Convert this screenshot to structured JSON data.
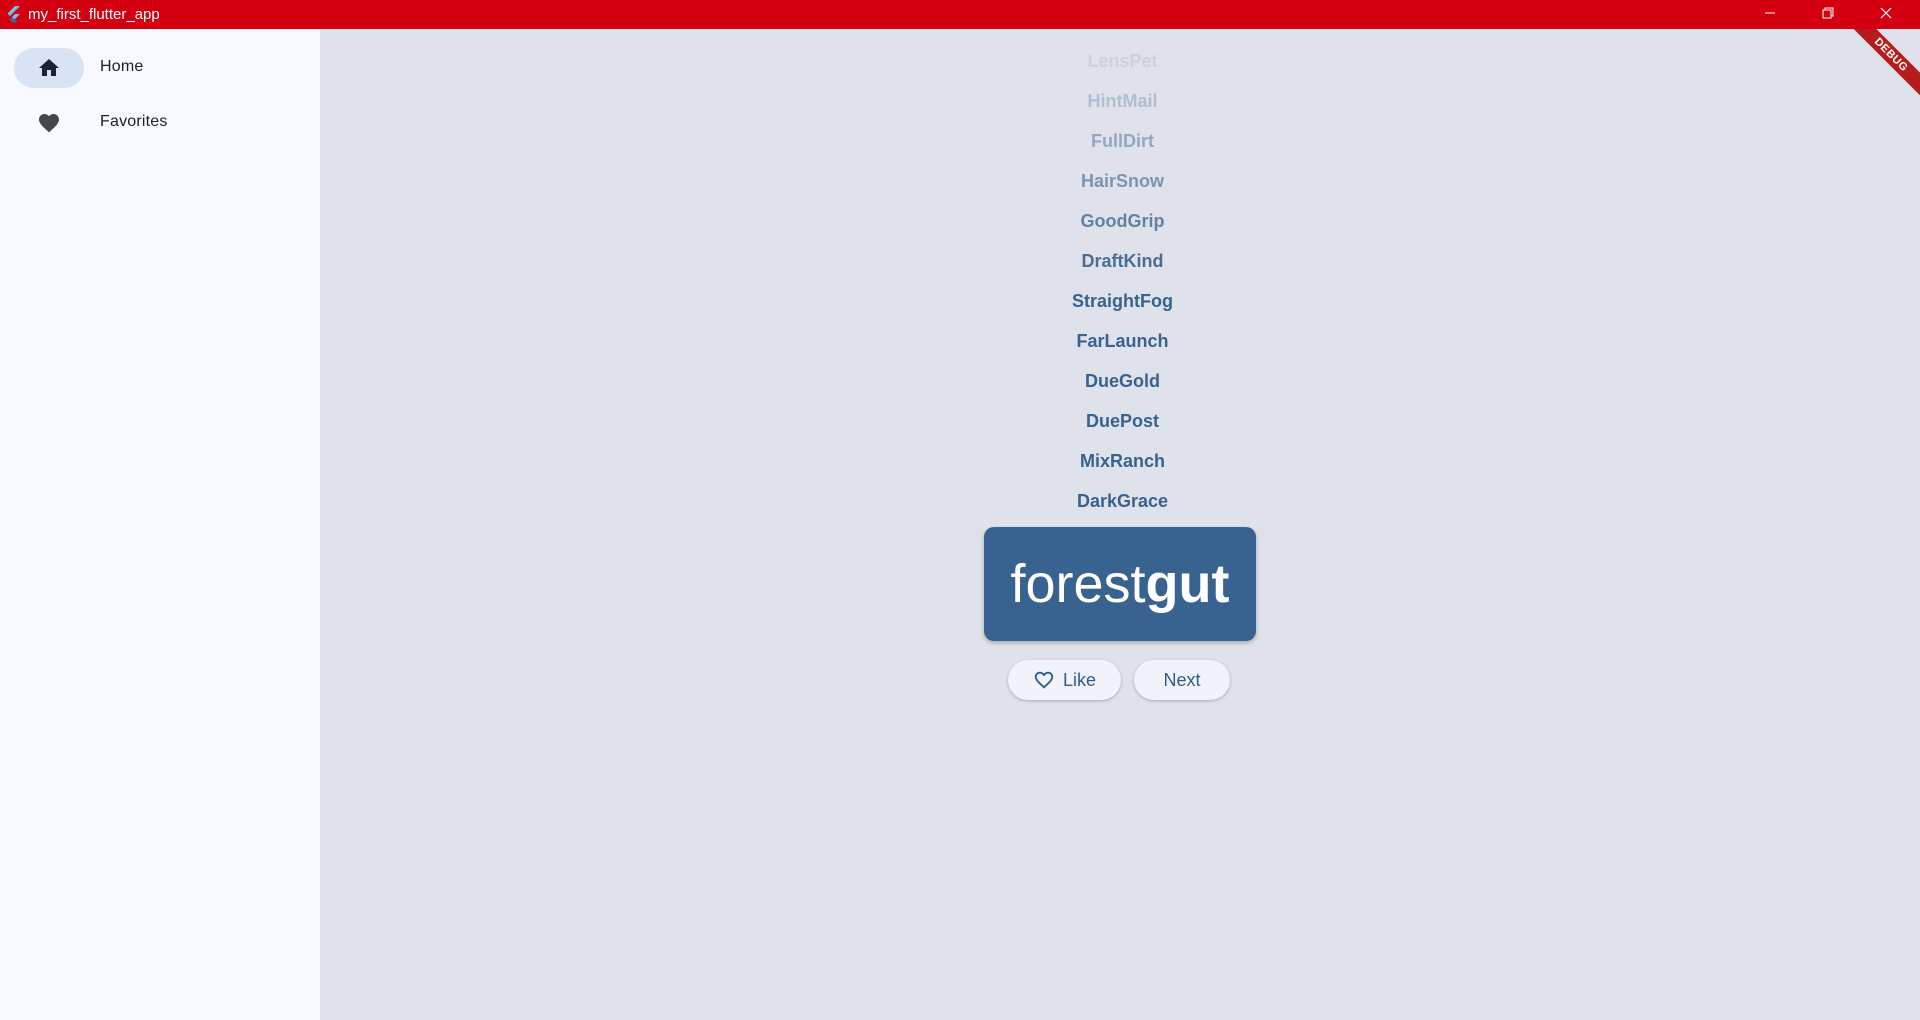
{
  "window": {
    "title": "my_first_flutter_app"
  },
  "colors": {
    "titlebar": "#d40012",
    "sidebar_bg": "#f7f9fe",
    "main_bg": "#dfe2ea",
    "primary": "#38628f",
    "nav_indicator": "#d8e3f4"
  },
  "sidebar": {
    "items": [
      {
        "label": "Home",
        "icon": "home-icon",
        "selected": true
      },
      {
        "label": "Favorites",
        "icon": "heart-icon",
        "selected": false
      }
    ]
  },
  "main": {
    "history": [
      {
        "word": "LensPet",
        "opacity": 0.12
      },
      {
        "word": "HintMail",
        "opacity": 0.28
      },
      {
        "word": "FullDirt",
        "opacity": 0.45
      },
      {
        "word": "HairSnow",
        "opacity": 0.6
      },
      {
        "word": "GoodGrip",
        "opacity": 0.75
      },
      {
        "word": "DraftKind",
        "opacity": 0.9
      },
      {
        "word": "StraightFog",
        "opacity": 1.0
      },
      {
        "word": "FarLaunch",
        "opacity": 1.0
      },
      {
        "word": "DueGold",
        "opacity": 1.0
      },
      {
        "word": "DuePost",
        "opacity": 1.0
      },
      {
        "word": "MixRanch",
        "opacity": 1.0
      },
      {
        "word": "DarkGrace",
        "opacity": 1.0
      }
    ],
    "current_pair": {
      "first": "forest",
      "second": "gut"
    },
    "like_label": "Like",
    "next_label": "Next"
  },
  "debug_banner": "DEBUG"
}
